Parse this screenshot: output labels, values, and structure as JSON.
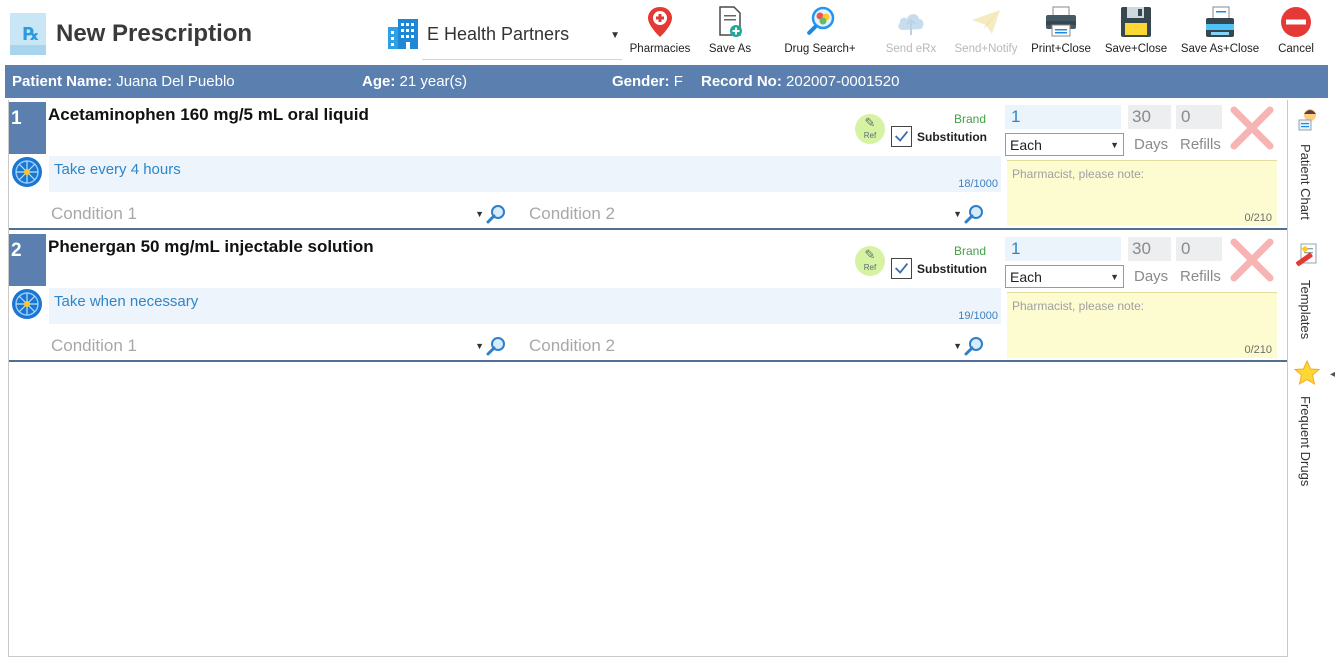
{
  "header": {
    "title": "New Prescription",
    "organization": "E Health Partners"
  },
  "toolbar": {
    "pharmacies": "Pharmacies",
    "save_as": "Save As",
    "drug_search": "Drug Search+",
    "send_erx": "Send eRx",
    "send_notify": "Send+Notify",
    "print_close": "Print+Close",
    "save_close": "Save+Close",
    "save_as_close": "Save As+Close",
    "cancel": "Cancel"
  },
  "patient": {
    "name_label": "Patient Name:",
    "name": "Juana Del Pueblo",
    "age_label": "Age:",
    "age": "21 year(s)",
    "gender_label": "Gender:",
    "gender": "F",
    "record_label": "Record No:",
    "record": "202007-0001520"
  },
  "prescriptions": [
    {
      "number": "1",
      "drug": "Acetaminophen 160 mg/5 mL oral liquid",
      "sig": "Take every 4 hours",
      "sig_count": "18/1000",
      "condition1": "Condition 1",
      "condition2": "Condition 2",
      "ref_label": "Ref",
      "brand": "Brand",
      "substitution": "Substitution",
      "substitution_checked": true,
      "quantity": "1",
      "unit": "Each",
      "days": "30",
      "days_label": "Days",
      "refills": "0",
      "refills_label": "Refills",
      "note_placeholder": "Pharmacist, please note:",
      "note_count": "0/210"
    },
    {
      "number": "2",
      "drug": "Phenergan 50 mg/mL injectable solution",
      "sig": "Take when necessary",
      "sig_count": "19/1000",
      "condition1": "Condition 1",
      "condition2": "Condition 2",
      "ref_label": "Ref",
      "brand": "Brand",
      "substitution": "Substitution",
      "substitution_checked": true,
      "quantity": "1",
      "unit": "Each",
      "days": "30",
      "days_label": "Days",
      "refills": "0",
      "refills_label": "Refills",
      "note_placeholder": "Pharmacist, please note:",
      "note_count": "0/210"
    }
  ],
  "side_panel": {
    "patient_chart": "Patient Chart",
    "templates": "Templates",
    "frequent_drugs": "Frequent Drugs"
  },
  "colors": {
    "patient_bar": "#5b80b0",
    "sig_text": "#2e86c9",
    "brand": "#43a047",
    "note_bg": "#fdfbd0",
    "cancel": "#e53935",
    "delete": "#f7b4b4"
  }
}
